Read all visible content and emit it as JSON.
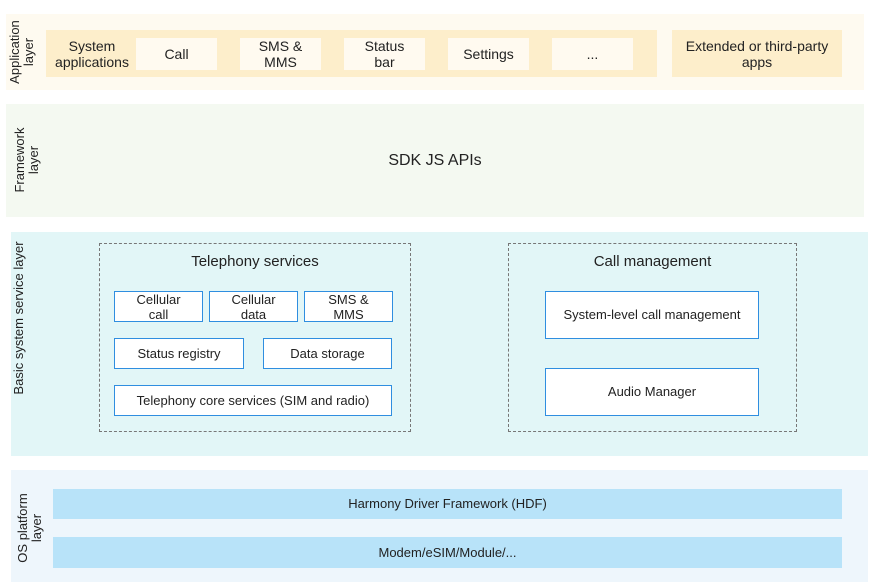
{
  "application_layer": {
    "label": "Application layer",
    "group_label": "System applications",
    "apps": [
      "Call",
      "SMS & MMS",
      "Status bar",
      "Settings",
      "..."
    ],
    "extended": "Extended or third-party apps"
  },
  "framework_layer": {
    "label": "Framework layer",
    "content": "SDK JS APIs"
  },
  "basic_layer": {
    "label": "Basic system service layer",
    "telephony": {
      "title": "Telephony services",
      "items": [
        "Cellular call",
        "Cellular data",
        "SMS & MMS",
        "Status registry",
        "Data storage",
        "Telephony core services (SIM and radio)"
      ]
    },
    "call_management": {
      "title": "Call management",
      "items": [
        "System-level call management",
        "Audio Manager"
      ]
    }
  },
  "os_layer": {
    "label": "OS platform layer",
    "items": [
      "Harmony Driver Framework (HDF)",
      "Modem/eSIM/Module/..."
    ]
  }
}
